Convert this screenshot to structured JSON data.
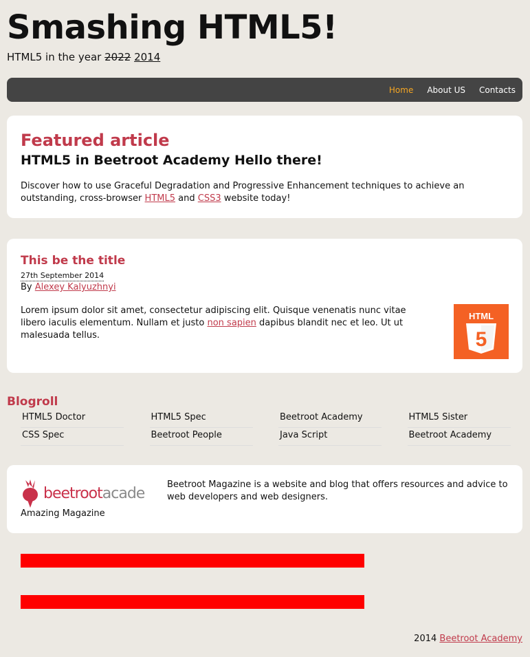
{
  "header": {
    "title": "Smashing HTML5!",
    "tagline_prefix": "HTML5 in the year",
    "tagline_old_year": "2022",
    "tagline_new_year": "2014"
  },
  "nav": {
    "items": [
      {
        "label": "Home",
        "active": true
      },
      {
        "label": "About US",
        "active": false
      },
      {
        "label": "Contacts",
        "active": false
      }
    ]
  },
  "featured": {
    "kicker": "Featured article",
    "headline": "HTML5 in Beetroot Academy Hello there!",
    "text_before": "Discover how to use Graceful Degradation and Progressive Enhancement techniques to achieve an outstanding, cross-browser",
    "link_html5": "HTML5",
    "text_and": "and",
    "link_css3": "CSS3",
    "text_after": "website today!"
  },
  "post": {
    "title": "This be the title",
    "date": "27th September 2014",
    "by_prefix": "By",
    "author": "Alexey Kalyuzhnyi",
    "body_before": "Lorem ipsum dolor sit amet, consectetur adipiscing elit. Quisque venenatis nunc vitae libero iaculis elementum. Nullam et justo",
    "body_link": "non sapien",
    "body_after": "dapibus blandit nec et leo. Ut ut malesuada tellus.",
    "logo_text": "HTML",
    "logo_digit": "5"
  },
  "blogroll": {
    "title": "Blogroll",
    "links": [
      "HTML5 Doctor",
      "HTML5 Spec",
      "Beetroot Academy",
      "HTML5 Sister",
      "CSS Spec",
      "Beetroot People",
      "Java Script",
      "Beetroot Academy"
    ]
  },
  "about": {
    "logo_text_bold": "beetroot",
    "logo_text_light": "acader",
    "caption": "Amazing Magazine",
    "description": "Beetroot Magazine is a website and blog that offers resources and advice to web developers and web designers."
  },
  "footer": {
    "year": "2014",
    "link": "Beetroot Academy"
  },
  "colors": {
    "background": "#ece9e3",
    "accent": "#c03a4b",
    "nav_active": "#f5a623",
    "nav_bg": "#444444",
    "html5_orange": "#f46124",
    "red_bar": "#ff0000"
  }
}
